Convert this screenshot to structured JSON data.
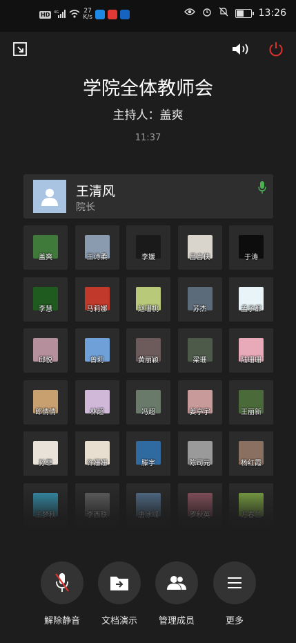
{
  "status_bar": {
    "network_badge": "HD",
    "signal_label": "4G",
    "speed_value": "27",
    "speed_unit": "K/s",
    "time": "13:26"
  },
  "meeting": {
    "title": "学院全体教师会",
    "host": "主持人：盖爽",
    "elapsed": "11:37"
  },
  "speaker": {
    "name": "王清风",
    "role": "院长"
  },
  "participants": [
    {
      "name": "盖爽",
      "color": "#3f7a3a"
    },
    {
      "name": "王诗柔",
      "color": "#8a9bb0"
    },
    {
      "name": "李媛",
      "color": "#1a1a1a"
    },
    {
      "name": "吕言侠",
      "color": "#d9d4cc"
    },
    {
      "name": "于涛",
      "color": "#0d0d0d"
    },
    {
      "name": "李慧",
      "color": "#1f5a1f"
    },
    {
      "name": "马莉娜",
      "color": "#c0392b"
    },
    {
      "name": "赵珊桃",
      "color": "#b9c97a"
    },
    {
      "name": "苏杰",
      "color": "#5c6b7a"
    },
    {
      "name": "孟子都",
      "color": "#e8f4f8"
    },
    {
      "name": "邱悦",
      "color": "#b58f9c"
    },
    {
      "name": "曾莉",
      "color": "#6fa0d8"
    },
    {
      "name": "黄丽颖",
      "color": "#6d5a5a"
    },
    {
      "name": "梁珊",
      "color": "#4d5a4a"
    },
    {
      "name": "陆珊珊",
      "color": "#e8a9b8"
    },
    {
      "name": "郎倩倩",
      "color": "#c8a070"
    },
    {
      "name": "林超",
      "color": "#d0b8d8"
    },
    {
      "name": "冯超",
      "color": "#6a7a6a"
    },
    {
      "name": "姜亭宇",
      "color": "#c99a9a"
    },
    {
      "name": "王丽新",
      "color": "#4a6a3a"
    },
    {
      "name": "孙菲",
      "color": "#e8e2d8"
    },
    {
      "name": "许姗姗",
      "color": "#e8dfd0"
    },
    {
      "name": "滕宇",
      "color": "#2f6aa0"
    },
    {
      "name": "陈司元",
      "color": "#9a9a9a"
    },
    {
      "name": "杨红霞",
      "color": "#8a7060"
    },
    {
      "name": "王梦秋",
      "color": "#3aa0c0"
    },
    {
      "name": "李西联",
      "color": "#6a6a6a"
    },
    {
      "name": "唐冰瑶",
      "color": "#5a7a9a"
    },
    {
      "name": "罗秋英",
      "color": "#9a5a6a"
    },
    {
      "name": "万春兰",
      "color": "#8ab84a"
    }
  ],
  "actions": {
    "unmute": "解除静音",
    "share_doc": "文档演示",
    "manage_members": "管理成员",
    "more": "更多"
  }
}
